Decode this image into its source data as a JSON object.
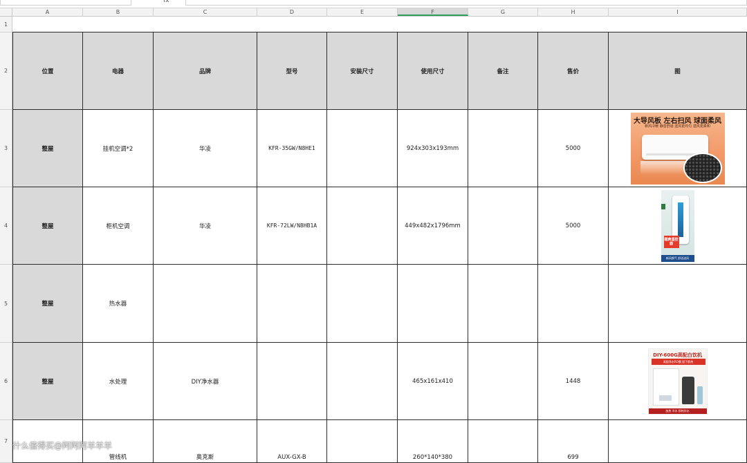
{
  "formula_bar": {
    "fx_label": "fx"
  },
  "columns": [
    "A",
    "B",
    "C",
    "D",
    "E",
    "F",
    "G",
    "H",
    "I"
  ],
  "selected_column": "F",
  "rows": [
    "1",
    "2",
    "3",
    "4",
    "5",
    "6",
    "7"
  ],
  "header": {
    "location": "位置",
    "appliance": "电器",
    "brand": "品牌",
    "model": "型号",
    "install_size": "安装尺寸",
    "use_size": "使用尺寸",
    "notes": "备注",
    "price": "售价",
    "image": "图"
  },
  "data_rows": [
    {
      "location": "整屋",
      "appliance": "挂机空调*2",
      "brand": "华凌",
      "model": "KFR-35GW/N8HE1",
      "install_size": "",
      "use_size": "924x303x193mm",
      "notes": "",
      "price": "5000",
      "image": "wall-ac-photo"
    },
    {
      "location": "整屋",
      "appliance": "柜机空调",
      "brand": "华凌",
      "model": "KFR-72LW/N8HB1A",
      "install_size": "",
      "use_size": "449x482x1796mm",
      "notes": "",
      "price": "5000",
      "image": "tower-ac-photo"
    },
    {
      "location": "整屋",
      "appliance": "热水器",
      "brand": "",
      "model": "",
      "install_size": "",
      "use_size": "",
      "notes": "",
      "price": "",
      "image": ""
    },
    {
      "location": "整屋",
      "appliance": "水处理",
      "brand": "DIY净水器",
      "model": "",
      "install_size": "",
      "use_size": "465x161x410",
      "notes": "",
      "price": "1448",
      "image": "water-purifier-photo"
    },
    {
      "location": "",
      "appliance": "管线机",
      "brand": "奥克斯",
      "model": "AUX-GX-B",
      "install_size": "",
      "use_size": "260*140*380",
      "notes": "",
      "price": "699",
      "image": ""
    }
  ],
  "images": {
    "ac": {
      "headline": "大导风板 左右扫风 球面柔风",
      "sub": "新风冷暖 静音舒适 送风更均匀 送风更柔和"
    },
    "tower": {
      "badge": "酷爽遥控器",
      "footer": "新风换气 舒适送风"
    },
    "water": {
      "headline": "DIY-600G高配白饮机",
      "bar": "高配净水RO膜 厨下即热",
      "footer": "加热 冷水 即热饮水"
    }
  },
  "watermark": "什么值得买@阿阿阿羊羊羊"
}
